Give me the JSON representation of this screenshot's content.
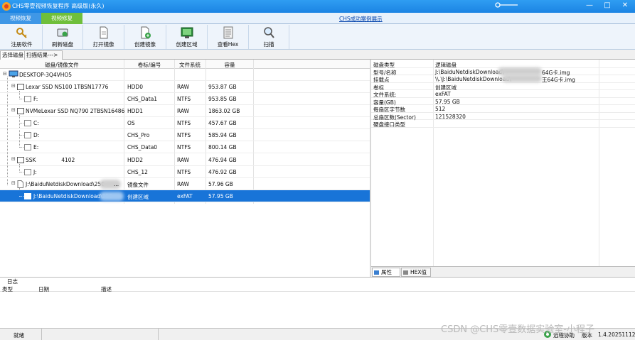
{
  "window": {
    "title": "CHS零壹视频恢复程序 高级版(永久)",
    "controls": [
      "—",
      "□",
      "✕"
    ]
  },
  "ribbon_tabs": [
    "视频恢复",
    "视频修复"
  ],
  "demo_link": "CHS成功案例展示",
  "toolbar": [
    {
      "label": "注册软件",
      "icon": "key-icon"
    },
    {
      "label": "刷新磁盘",
      "icon": "refresh-disk-icon"
    },
    {
      "label": "打开镜像",
      "icon": "open-image-icon"
    },
    {
      "label": "创建镜像",
      "icon": "create-image-icon"
    },
    {
      "label": "创建区域",
      "icon": "create-region-icon"
    },
    {
      "label": "查看Hex",
      "icon": "hex-view-icon"
    },
    {
      "label": "扫描",
      "icon": "scan-icon"
    }
  ],
  "subtabs": [
    "选择磁盘",
    "扫描结果--->"
  ],
  "disk_table": {
    "headers": [
      "磁盘/镜像文件",
      "卷标/编号",
      "文件系统",
      "容量"
    ],
    "rows": [
      {
        "name": "DESKTOP-3Q4VHO5",
        "label": "",
        "fs": "",
        "size": ""
      },
      {
        "name": "Lexar SSD NS100 1TBSN17776",
        "label": "HDD0",
        "fs": "RAW",
        "size": "953.87 GB"
      },
      {
        "name": "F:",
        "label": "CHS_Data1",
        "fs": "NTFS",
        "size": "953.85 GB"
      },
      {
        "name": "NVMeLexar SSD NQ790 2TBSN16486",
        "label": "HDD1",
        "fs": "RAW",
        "size": "1863.02 GB"
      },
      {
        "name": "C:",
        "label": "OS",
        "fs": "NTFS",
        "size": "457.67 GB"
      },
      {
        "name": "D:",
        "label": "CHS_Pro",
        "fs": "NTFS",
        "size": "585.94 GB"
      },
      {
        "name": "E:",
        "label": "CHS_Data0",
        "fs": "NTFS",
        "size": "800.14 GB"
      },
      {
        "name": "SSK               4102",
        "label": "HDD2",
        "fs": "RAW",
        "size": "476.94 GB"
      },
      {
        "name": "J:",
        "label": "CHS_12",
        "fs": "NTFS",
        "size": "476.92 GB"
      },
      {
        "name": "J:\\BaiduNetdiskDownload\\250",
        "suffix": "...",
        "label": "镜像文件",
        "fs": "RAW",
        "size": "57.96 GB"
      },
      {
        "name": "J:\\BaiduNetdiskDownload\\250",
        "suffix": "",
        "label": "创建区域",
        "fs": "exFAT",
        "size": "57.95 GB"
      }
    ]
  },
  "properties": [
    {
      "key": "磁盘类型",
      "value": "逻辑磁盘"
    },
    {
      "key": "型号/名称",
      "value": "J:\\BaiduNetdiskDownload\\",
      "value2": "64G卡.img"
    },
    {
      "key": "挂载点",
      "value": "\\\\.\\J:\\BaiduNetdiskDownload\\",
      "value2": "王64G卡.img"
    },
    {
      "key": "卷标",
      "value": "创建区域"
    },
    {
      "key": "文件系统:",
      "value": "exFAT"
    },
    {
      "key": "容量(GB)",
      "value": "57.95 GB"
    },
    {
      "key": "每扇区字节数",
      "value": "512"
    },
    {
      "key": "总扇区数(Sector)",
      "value": "121528320"
    },
    {
      "key": "硬盘接口类型",
      "value": ""
    }
  ],
  "props_tabs": [
    "属性",
    "HEX值"
  ],
  "log": {
    "title": "日志",
    "headers": [
      "类型",
      "日期",
      "描述"
    ]
  },
  "status": {
    "text": "就绪",
    "right1": "远程协助",
    "right2": "版本",
    "version": "1.4.20251112"
  },
  "watermark": "CSDN @CHS零壹数据实验室-小程子"
}
